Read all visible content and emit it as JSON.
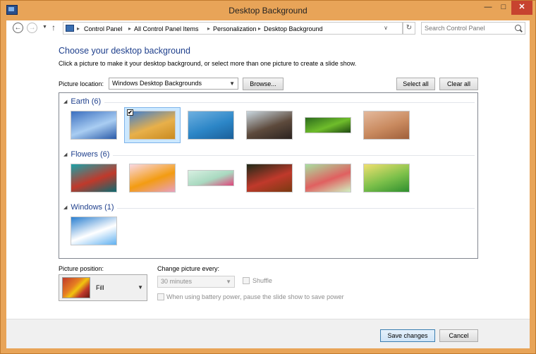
{
  "window": {
    "title": "Desktop Background",
    "minimize_glyph": "—",
    "maximize_glyph": "□",
    "close_glyph": "✕"
  },
  "nav": {
    "back_glyph": "←",
    "forward_glyph": "→",
    "recent_glyph": "▼",
    "up_glyph": "↑"
  },
  "breadcrumb": [
    "Control Panel",
    "All Control Panel Items",
    "Personalization",
    "Desktop Background"
  ],
  "address": {
    "dropdown_glyph": "∨",
    "refresh_glyph": "↻"
  },
  "search": {
    "placeholder": "Search Control Panel"
  },
  "main": {
    "heading": "Choose your desktop background",
    "description": "Click a picture to make it your desktop background, or select more than one picture to create a slide show.",
    "picture_location_label": "Picture location:",
    "picture_location_value": "Windows Desktop Backgrounds",
    "browse_label": "Browse...",
    "select_all_label": "Select all",
    "clear_all_label": "Clear all"
  },
  "groups": [
    {
      "name": "Earth (6)",
      "thumbs": [
        {
          "colors": [
            "#3b6fbf",
            "#a9cdf2",
            "#2a5aa8"
          ],
          "selected": false,
          "wide": false
        },
        {
          "colors": [
            "#3f7fd0",
            "#e8b04a",
            "#c98a1f"
          ],
          "selected": true,
          "wide": false
        },
        {
          "colors": [
            "#6fb0e0",
            "#2c86c7",
            "#1b5f99"
          ],
          "selected": false,
          "wide": false
        },
        {
          "colors": [
            "#c9d6de",
            "#5d4a3c",
            "#2b2320"
          ],
          "selected": false,
          "wide": false
        },
        {
          "colors": [
            "#2c6b1d",
            "#6fbd2b",
            "#1f4a12"
          ],
          "selected": false,
          "wide": true
        },
        {
          "colors": [
            "#e4b99c",
            "#c98a5f",
            "#9f5f3a"
          ],
          "selected": false,
          "wide": false
        }
      ]
    },
    {
      "name": "Flowers (6)",
      "thumbs": [
        {
          "colors": [
            "#1aa2a8",
            "#c0392b",
            "#0d6a70"
          ],
          "selected": false,
          "wide": false
        },
        {
          "colors": [
            "#f9d8e4",
            "#f39c12",
            "#e8a0c0"
          ],
          "selected": false,
          "wide": false
        },
        {
          "colors": [
            "#d8f0e2",
            "#a9d9c0",
            "#e0457b"
          ],
          "selected": false,
          "wide": true
        },
        {
          "colors": [
            "#1f2a18",
            "#c0392b",
            "#7a3a12"
          ],
          "selected": false,
          "wide": false
        },
        {
          "colors": [
            "#a8e0a0",
            "#e06060",
            "#d0f0c0"
          ],
          "selected": false,
          "wide": false
        },
        {
          "colors": [
            "#f0e070",
            "#7cc04a",
            "#2f8f2f"
          ],
          "selected": false,
          "wide": false
        }
      ]
    },
    {
      "name": "Windows (1)",
      "thumbs": [
        {
          "colors": [
            "#2a7fd0",
            "#ffffff",
            "#5fb0f0"
          ],
          "selected": false,
          "wide": false
        }
      ]
    }
  ],
  "position": {
    "label": "Picture position:",
    "value": "Fill"
  },
  "slideshow": {
    "change_label": "Change picture every:",
    "interval_value": "30 minutes",
    "shuffle_label": "Shuffle",
    "battery_label": "When using battery power, pause the slide show to save power"
  },
  "footer": {
    "save_label": "Save changes",
    "cancel_label": "Cancel"
  },
  "colors": {
    "accent": "#1e3f8c",
    "frame": "#e8a458",
    "close": "#c7432f"
  }
}
